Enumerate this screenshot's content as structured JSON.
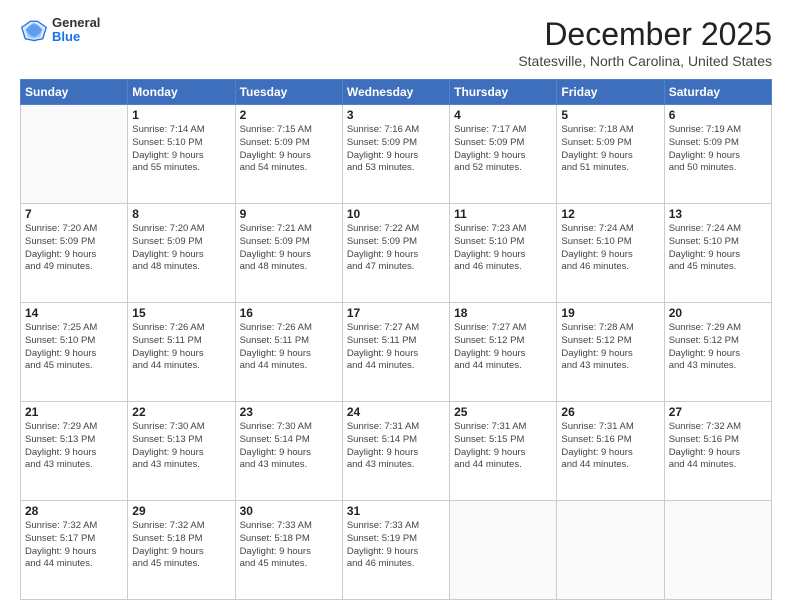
{
  "logo": {
    "general": "General",
    "blue": "Blue"
  },
  "header": {
    "month": "December 2025",
    "location": "Statesville, North Carolina, United States"
  },
  "days_of_week": [
    "Sunday",
    "Monday",
    "Tuesday",
    "Wednesday",
    "Thursday",
    "Friday",
    "Saturday"
  ],
  "weeks": [
    [
      {
        "day": "",
        "info": ""
      },
      {
        "day": "1",
        "info": "Sunrise: 7:14 AM\nSunset: 5:10 PM\nDaylight: 9 hours\nand 55 minutes."
      },
      {
        "day": "2",
        "info": "Sunrise: 7:15 AM\nSunset: 5:09 PM\nDaylight: 9 hours\nand 54 minutes."
      },
      {
        "day": "3",
        "info": "Sunrise: 7:16 AM\nSunset: 5:09 PM\nDaylight: 9 hours\nand 53 minutes."
      },
      {
        "day": "4",
        "info": "Sunrise: 7:17 AM\nSunset: 5:09 PM\nDaylight: 9 hours\nand 52 minutes."
      },
      {
        "day": "5",
        "info": "Sunrise: 7:18 AM\nSunset: 5:09 PM\nDaylight: 9 hours\nand 51 minutes."
      },
      {
        "day": "6",
        "info": "Sunrise: 7:19 AM\nSunset: 5:09 PM\nDaylight: 9 hours\nand 50 minutes."
      }
    ],
    [
      {
        "day": "7",
        "info": "Sunrise: 7:20 AM\nSunset: 5:09 PM\nDaylight: 9 hours\nand 49 minutes."
      },
      {
        "day": "8",
        "info": "Sunrise: 7:20 AM\nSunset: 5:09 PM\nDaylight: 9 hours\nand 48 minutes."
      },
      {
        "day": "9",
        "info": "Sunrise: 7:21 AM\nSunset: 5:09 PM\nDaylight: 9 hours\nand 48 minutes."
      },
      {
        "day": "10",
        "info": "Sunrise: 7:22 AM\nSunset: 5:09 PM\nDaylight: 9 hours\nand 47 minutes."
      },
      {
        "day": "11",
        "info": "Sunrise: 7:23 AM\nSunset: 5:10 PM\nDaylight: 9 hours\nand 46 minutes."
      },
      {
        "day": "12",
        "info": "Sunrise: 7:24 AM\nSunset: 5:10 PM\nDaylight: 9 hours\nand 46 minutes."
      },
      {
        "day": "13",
        "info": "Sunrise: 7:24 AM\nSunset: 5:10 PM\nDaylight: 9 hours\nand 45 minutes."
      }
    ],
    [
      {
        "day": "14",
        "info": "Sunrise: 7:25 AM\nSunset: 5:10 PM\nDaylight: 9 hours\nand 45 minutes."
      },
      {
        "day": "15",
        "info": "Sunrise: 7:26 AM\nSunset: 5:11 PM\nDaylight: 9 hours\nand 44 minutes."
      },
      {
        "day": "16",
        "info": "Sunrise: 7:26 AM\nSunset: 5:11 PM\nDaylight: 9 hours\nand 44 minutes."
      },
      {
        "day": "17",
        "info": "Sunrise: 7:27 AM\nSunset: 5:11 PM\nDaylight: 9 hours\nand 44 minutes."
      },
      {
        "day": "18",
        "info": "Sunrise: 7:27 AM\nSunset: 5:12 PM\nDaylight: 9 hours\nand 44 minutes."
      },
      {
        "day": "19",
        "info": "Sunrise: 7:28 AM\nSunset: 5:12 PM\nDaylight: 9 hours\nand 43 minutes."
      },
      {
        "day": "20",
        "info": "Sunrise: 7:29 AM\nSunset: 5:12 PM\nDaylight: 9 hours\nand 43 minutes."
      }
    ],
    [
      {
        "day": "21",
        "info": "Sunrise: 7:29 AM\nSunset: 5:13 PM\nDaylight: 9 hours\nand 43 minutes."
      },
      {
        "day": "22",
        "info": "Sunrise: 7:30 AM\nSunset: 5:13 PM\nDaylight: 9 hours\nand 43 minutes."
      },
      {
        "day": "23",
        "info": "Sunrise: 7:30 AM\nSunset: 5:14 PM\nDaylight: 9 hours\nand 43 minutes."
      },
      {
        "day": "24",
        "info": "Sunrise: 7:31 AM\nSunset: 5:14 PM\nDaylight: 9 hours\nand 43 minutes."
      },
      {
        "day": "25",
        "info": "Sunrise: 7:31 AM\nSunset: 5:15 PM\nDaylight: 9 hours\nand 44 minutes."
      },
      {
        "day": "26",
        "info": "Sunrise: 7:31 AM\nSunset: 5:16 PM\nDaylight: 9 hours\nand 44 minutes."
      },
      {
        "day": "27",
        "info": "Sunrise: 7:32 AM\nSunset: 5:16 PM\nDaylight: 9 hours\nand 44 minutes."
      }
    ],
    [
      {
        "day": "28",
        "info": "Sunrise: 7:32 AM\nSunset: 5:17 PM\nDaylight: 9 hours\nand 44 minutes."
      },
      {
        "day": "29",
        "info": "Sunrise: 7:32 AM\nSunset: 5:18 PM\nDaylight: 9 hours\nand 45 minutes."
      },
      {
        "day": "30",
        "info": "Sunrise: 7:33 AM\nSunset: 5:18 PM\nDaylight: 9 hours\nand 45 minutes."
      },
      {
        "day": "31",
        "info": "Sunrise: 7:33 AM\nSunset: 5:19 PM\nDaylight: 9 hours\nand 46 minutes."
      },
      {
        "day": "",
        "info": ""
      },
      {
        "day": "",
        "info": ""
      },
      {
        "day": "",
        "info": ""
      }
    ]
  ]
}
